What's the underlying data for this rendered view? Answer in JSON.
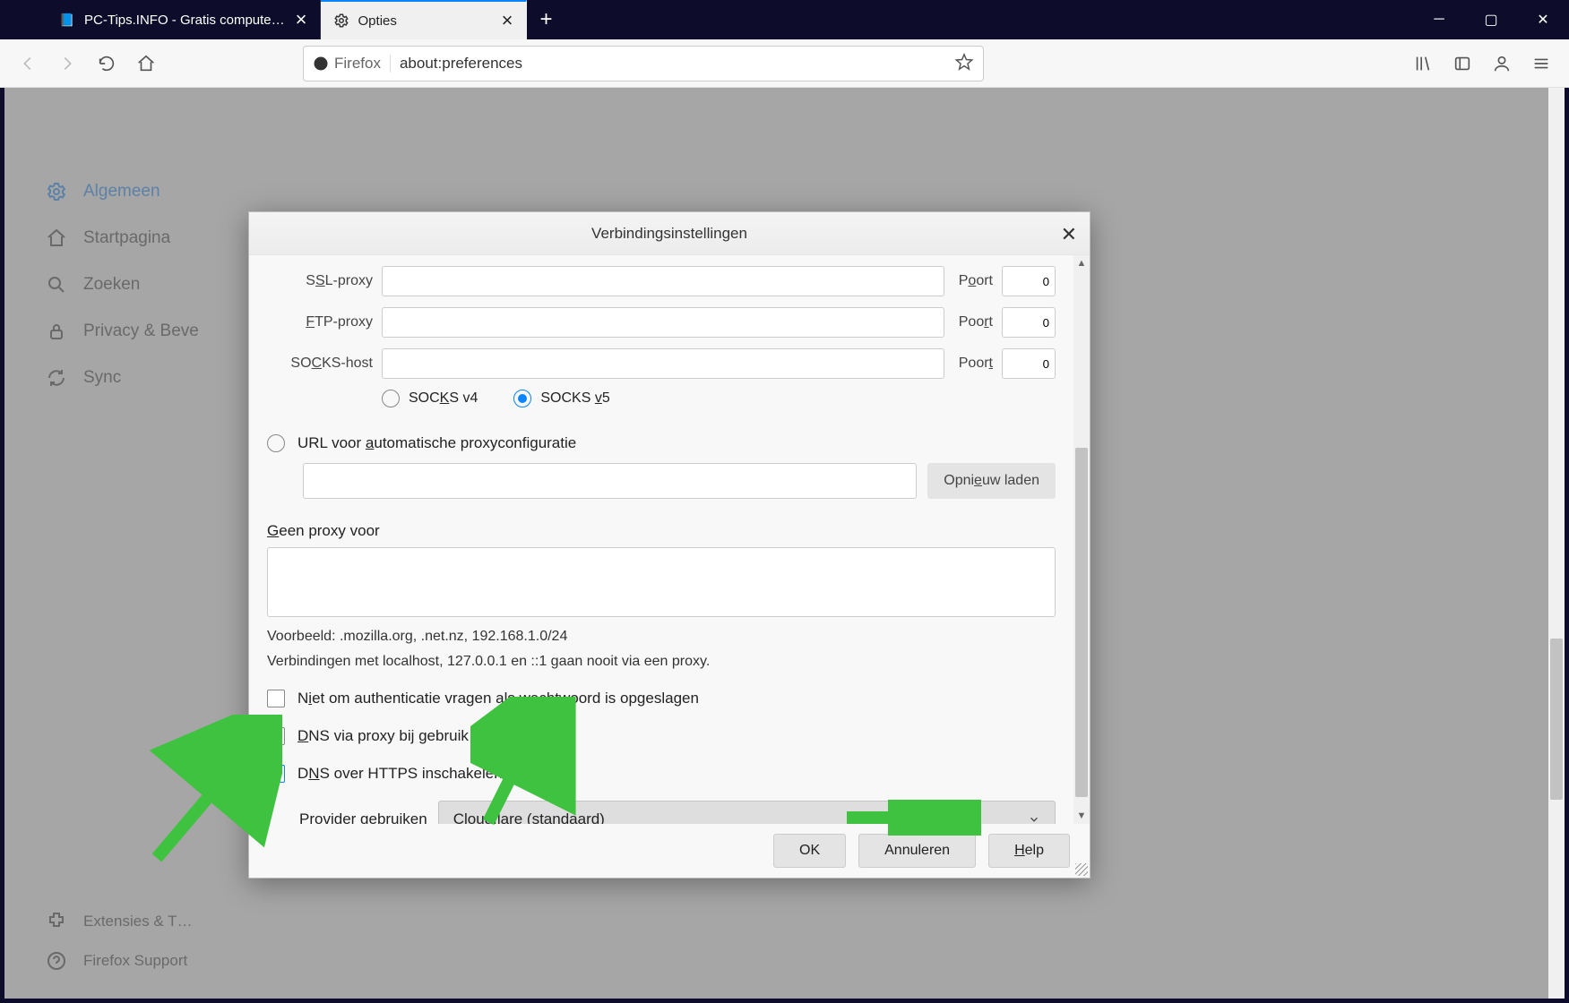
{
  "tabs": [
    {
      "label": "PC-Tips.INFO - Gratis compute…",
      "active": false
    },
    {
      "label": "Opties",
      "active": true
    }
  ],
  "url": {
    "identity": "Firefox",
    "value": "about:preferences"
  },
  "sidebar": {
    "items": [
      {
        "label": "Algemeen",
        "active": true
      },
      {
        "label": "Startpagina"
      },
      {
        "label": "Zoeken"
      },
      {
        "label": "Privacy & Beve"
      },
      {
        "label": "Sync"
      }
    ],
    "bottom": [
      {
        "label": "Extensies & T…"
      },
      {
        "label": "Firefox Support"
      }
    ]
  },
  "dialog": {
    "title": "Verbindingsinstellingen",
    "ssl_label": "SSL-proxy",
    "ftp_label": "FTP-proxy",
    "socks_label": "SOCKS-host",
    "port_label": "Poort",
    "port_ssl": "0",
    "port_ftp": "0",
    "port_socks": "0",
    "socks_v4": "SOCKS v4",
    "socks_v5": "SOCKS v5",
    "auto_url": "URL voor automatische proxyconfiguratie",
    "reload": "Opnieuw laden",
    "no_proxy_label": "Geen proxy voor",
    "no_proxy_value": "",
    "example": "Voorbeeld: .mozilla.org, .net.nz, 192.168.1.0/24",
    "localhost_note": "Verbindingen met localhost, 127.0.0.1 en ::1 gaan nooit via een proxy.",
    "chk_auth": "Niet om authenticatie vragen als wachtwoord is opgeslagen",
    "chk_dns_socks": "DNS via proxy bij gebruik van SOCKS v5",
    "chk_dns_https": "DNS over HTTPS inschakelen",
    "provider_label": "Provider gebruiken",
    "provider_value": "Cloudflare (standaard)",
    "btn_ok": "OK",
    "btn_cancel": "Annuleren",
    "btn_help": "Help"
  }
}
